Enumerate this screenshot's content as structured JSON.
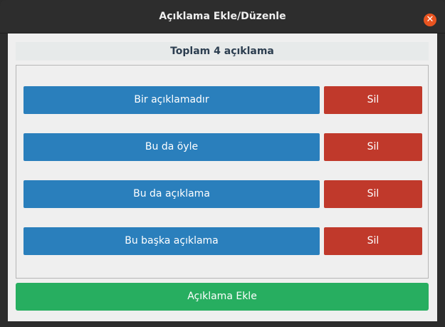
{
  "window": {
    "title": "Açıklama Ekle/Düzenle",
    "close_glyph": "✕"
  },
  "summary": "Toplam 4 açıklama",
  "descriptions": [
    {
      "label": "Bir açıklamadır",
      "delete_label": "Sil"
    },
    {
      "label": "Bu da öyle",
      "delete_label": "Sil"
    },
    {
      "label": "Bu da açıklama",
      "delete_label": "Sil"
    },
    {
      "label": "Bu başka açıklama",
      "delete_label": "Sil"
    }
  ],
  "add_button_label": "Açıklama Ekle",
  "colors": {
    "primary": "#2a7fbc",
    "danger": "#c0392b",
    "success": "#27ae60",
    "close": "#e95420"
  },
  "icons": {
    "close": "close-icon"
  }
}
